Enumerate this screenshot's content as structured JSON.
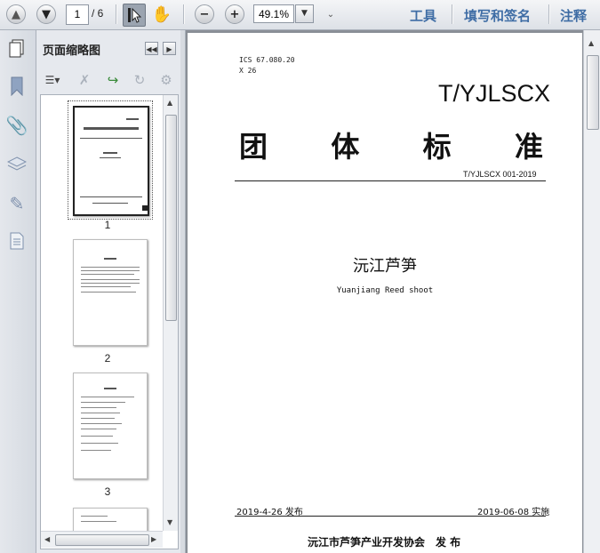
{
  "toolbar": {
    "current_page": "1",
    "total_pages": "/ 6",
    "zoom": "49.1%",
    "tools_label": "工具",
    "fill_sign_label": "填写和签名",
    "comment_label": "注释"
  },
  "thumbnail_panel": {
    "title": "页面缩略图",
    "pages": [
      "1",
      "2",
      "3"
    ]
  },
  "document": {
    "ics_line1": "ICS 67.080.20",
    "ics_line2": "X 26",
    "standard_code": "T/YJLSCX",
    "standard_type_chars": [
      "团",
      "体",
      "标",
      "准"
    ],
    "standard_number": "T/YJLSCX 001-2019",
    "title_cn": "沅江芦笋",
    "title_en": "Yuanjiang Reed shoot",
    "publish_date": "2019-4-26 发布",
    "implement_date": "2019-06-08 实施",
    "publisher": "沅江市芦笋产业开发协会　发 布"
  }
}
